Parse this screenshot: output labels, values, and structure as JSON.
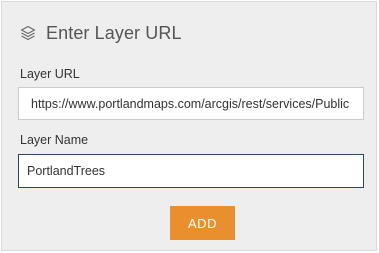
{
  "header": {
    "icon": "layers-icon",
    "title": "Enter Layer URL"
  },
  "form": {
    "url_label": "Layer URL",
    "url_value": "https://www.portlandmaps.com/arcgis/rest/services/Public",
    "name_label": "Layer Name",
    "name_value": "PortlandTrees",
    "add_label": "ADD"
  },
  "colors": {
    "panel_background": "#eeeeee",
    "button_accent": "#ea8f2d",
    "focused_input_border": "#29496b"
  }
}
